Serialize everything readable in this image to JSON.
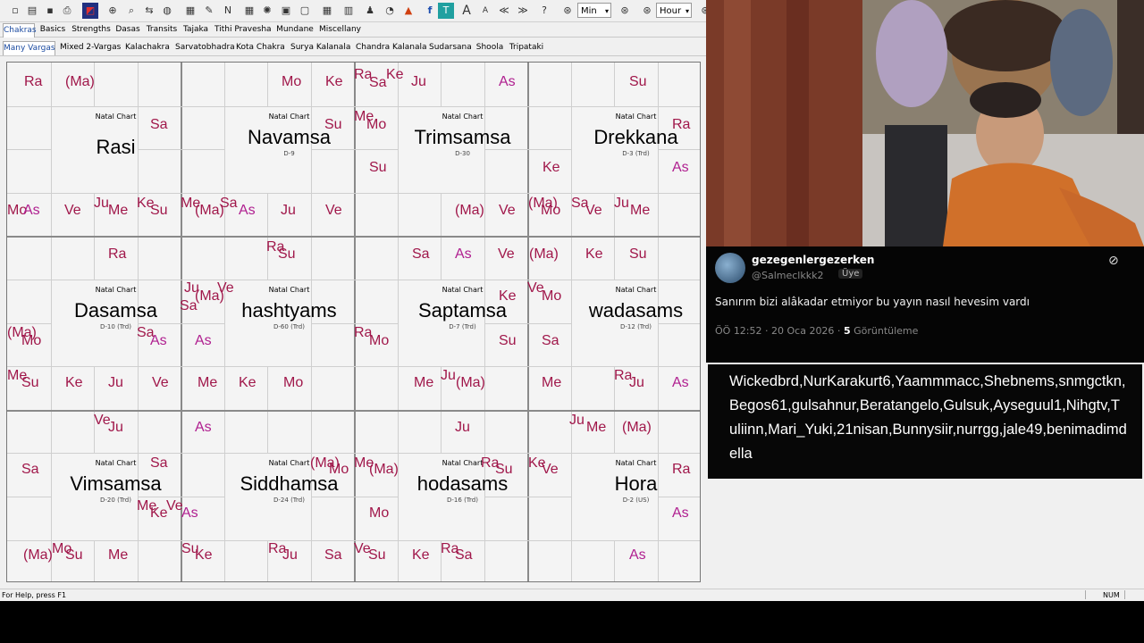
{
  "toolbar": {
    "select_min": "Min",
    "select_hour": "Hour"
  },
  "tabs_top": [
    "Chakras",
    "Basics",
    "Strengths",
    "Dasas",
    "Transits",
    "Tajaka",
    "Tithi Pravesha",
    "Mundane",
    "Miscellany"
  ],
  "tabs_sub": [
    "Many Vargas",
    "Mixed 2-Vargas",
    "Kalachakra",
    "Sarvatobhadra",
    "Kota Chakra",
    "Surya Kalanala",
    "Chandra Kalanala",
    "Sudarsana",
    "Shoola",
    "Tripataki"
  ],
  "charts": [
    {
      "name": "Rasi",
      "label": "Natal Chart",
      "sub": ""
    },
    {
      "name": "Navamsa",
      "label": "Natal Chart",
      "sub": "D-9"
    },
    {
      "name": "Trimsamsa",
      "label": "Natal Chart",
      "sub": "D-30"
    },
    {
      "name": "Drekkana",
      "label": "Natal Chart",
      "sub": "D-3 (Trd)"
    },
    {
      "name": "Dasamsa",
      "label": "Natal Chart",
      "sub": "D-10 (Trd)"
    },
    {
      "name": "hashtyams",
      "label": "Natal Chart",
      "sub": "D-60 (Trd)"
    },
    {
      "name": "Saptamsa",
      "label": "Natal Chart",
      "sub": "D-7 (Trd)"
    },
    {
      "name": "wadasams",
      "label": "Natal Chart",
      "sub": "D-12 (Trd)"
    },
    {
      "name": "Vimsamsa",
      "label": "Natal Chart",
      "sub": "D-20 (Trd)"
    },
    {
      "name": "Siddhamsa",
      "label": "Natal Chart",
      "sub": "D-24 (Trd)"
    },
    {
      "name": "hodasams",
      "label": "Natal Chart",
      "sub": "D-16 (Trd)"
    },
    {
      "name": "Hora",
      "label": "Natal Chart",
      "sub": "D-2 (US)"
    }
  ],
  "planets": [
    {
      "t": "Ra"
    },
    {
      "t": "(Ma)"
    },
    {
      "t": "Mo"
    },
    {
      "t": "Ke"
    },
    {
      "t": "Ra"
    },
    {
      "t": "Sa"
    },
    {
      "t": "Ke"
    },
    {
      "t": "Ju"
    },
    {
      "t": "As",
      "as": 1
    },
    {
      "t": "Su"
    },
    {
      "t": "Sa"
    },
    {
      "t": "Su"
    },
    {
      "t": "Me"
    },
    {
      "t": "Mo"
    },
    {
      "t": "Ra"
    },
    {
      "t": "Su"
    },
    {
      "t": "Ke"
    },
    {
      "t": "As",
      "as": 1
    },
    {
      "t": "Mo"
    },
    {
      "t": "As",
      "as": 1
    },
    {
      "t": "Ve"
    },
    {
      "t": "Ju"
    },
    {
      "t": "Me"
    },
    {
      "t": "Ke"
    },
    {
      "t": "Su"
    },
    {
      "t": "Me"
    },
    {
      "t": "(Ma)"
    },
    {
      "t": "Sa"
    },
    {
      "t": "As",
      "as": 1
    },
    {
      "t": "Ju"
    },
    {
      "t": "Ve"
    },
    {
      "t": "(Ma)"
    },
    {
      "t": "Ve"
    },
    {
      "t": "(Ma)"
    },
    {
      "t": "Mo"
    },
    {
      "t": "Sa"
    },
    {
      "t": "Ve"
    },
    {
      "t": "Ju"
    },
    {
      "t": "Me"
    },
    {
      "t": "Ra"
    },
    {
      "t": "Ra"
    },
    {
      "t": "Su"
    },
    {
      "t": "Sa"
    },
    {
      "t": "As",
      "as": 1
    },
    {
      "t": "Ve"
    },
    {
      "t": "(Ma)"
    },
    {
      "t": "Ke"
    },
    {
      "t": "Su"
    },
    {
      "t": "Ju"
    },
    {
      "t": "(Ma)"
    },
    {
      "t": "Ve"
    },
    {
      "t": "Sa"
    },
    {
      "t": "Ke"
    },
    {
      "t": "Ve"
    },
    {
      "t": "Mo"
    },
    {
      "t": "(Ma)"
    },
    {
      "t": "Mo"
    },
    {
      "t": "Sa"
    },
    {
      "t": "As",
      "as": 1
    },
    {
      "t": "As",
      "as": 1
    },
    {
      "t": "Ra"
    },
    {
      "t": "Mo"
    },
    {
      "t": "Su"
    },
    {
      "t": "Sa"
    },
    {
      "t": "Me"
    },
    {
      "t": "Su"
    },
    {
      "t": "Ke"
    },
    {
      "t": "Ju"
    },
    {
      "t": "Ve"
    },
    {
      "t": "Me"
    },
    {
      "t": "Ke"
    },
    {
      "t": "Mo"
    },
    {
      "t": "Me"
    },
    {
      "t": "Ju"
    },
    {
      "t": "(Ma)"
    },
    {
      "t": "Me"
    },
    {
      "t": "Ra"
    },
    {
      "t": "Ju"
    },
    {
      "t": "As",
      "as": 1
    },
    {
      "t": "Ve"
    },
    {
      "t": "Ju"
    },
    {
      "t": "As",
      "as": 1
    },
    {
      "t": "Ju"
    },
    {
      "t": "Ju"
    },
    {
      "t": "Me"
    },
    {
      "t": "(Ma)"
    },
    {
      "t": "Sa"
    },
    {
      "t": "Sa"
    },
    {
      "t": "(Ma)"
    },
    {
      "t": "Mo"
    },
    {
      "t": "Me"
    },
    {
      "t": "(Ma)"
    },
    {
      "t": "Ra"
    },
    {
      "t": "Su"
    },
    {
      "t": "Ke"
    },
    {
      "t": "Ve"
    },
    {
      "t": "Ra"
    },
    {
      "t": "Me"
    },
    {
      "t": "Ke"
    },
    {
      "t": "Ve"
    },
    {
      "t": "As",
      "as": 1
    },
    {
      "t": "Mo"
    },
    {
      "t": "As",
      "as": 1
    },
    {
      "t": "(Ma)"
    },
    {
      "t": "Mo"
    },
    {
      "t": "Su"
    },
    {
      "t": "Me"
    },
    {
      "t": "Su"
    },
    {
      "t": "Ke"
    },
    {
      "t": "Ra"
    },
    {
      "t": "Ju"
    },
    {
      "t": "Sa"
    },
    {
      "t": "Ve"
    },
    {
      "t": "Su"
    },
    {
      "t": "Ke"
    },
    {
      "t": "Ra"
    },
    {
      "t": "Sa"
    },
    {
      "t": "As",
      "as": 1
    }
  ],
  "status": {
    "left": "For Help, press F1",
    "right": "NUM"
  },
  "tweet": {
    "name": "gezegenlergezerken",
    "handle": "@Salmeclkkk2",
    "badge": "Üye",
    "text": "Sanırım bizi alâkadar etmiyor bu yayın nasıl hevesim vardı",
    "time": "ÖÖ 12:52 · 20 Oca 2026 ·",
    "views": "5",
    "views_label": "Görüntüleme"
  },
  "chat": {
    "text": "Wickedbrd,NurKarakurt6,Yaammmacc,Shebnems,snmgctkn,Begos61,gulsahnur,Beratangelo,Gulsuk,Ayseguul1,Nihgtv,Tuliinn,Mari_Yuki,21nisan,Bunnysiir,nurrgg,jale49,benimadimdella"
  }
}
